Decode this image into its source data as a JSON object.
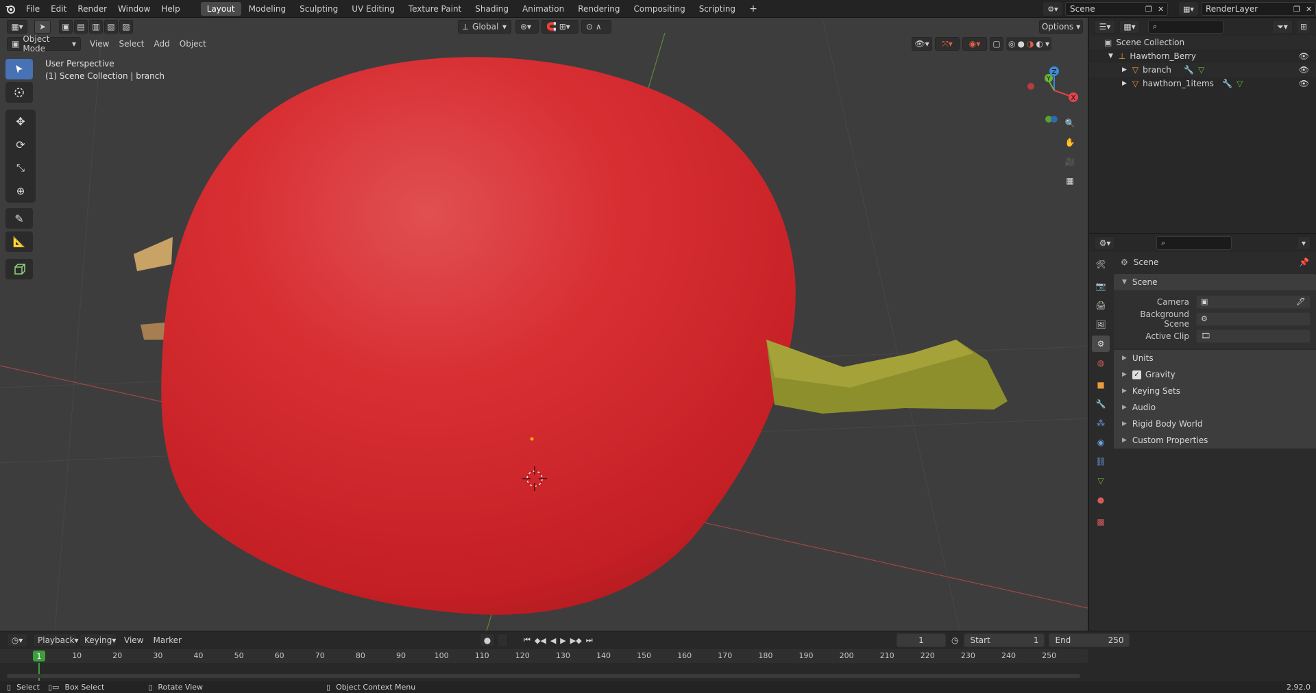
{
  "menu": [
    "File",
    "Edit",
    "Render",
    "Window",
    "Help"
  ],
  "workspaces": [
    "Layout",
    "Modeling",
    "Sculpting",
    "UV Editing",
    "Texture Paint",
    "Shading",
    "Animation",
    "Rendering",
    "Compositing",
    "Scripting"
  ],
  "active_workspace": "Layout",
  "scene_name": "Scene",
  "view_layer": "RenderLayer",
  "viewport": {
    "mode": "Object Mode",
    "menus": [
      "View",
      "Select",
      "Add",
      "Object"
    ],
    "transform_orientation": "Global",
    "options_label": "Options",
    "overlay_line1": "User Perspective",
    "overlay_line2": "(1) Scene Collection | branch",
    "gizmo_axes": {
      "x": "X",
      "y": "Y",
      "z": "Z"
    }
  },
  "outliner": {
    "root": "Scene Collection",
    "items": [
      {
        "label": "Hawthorn_Berry"
      },
      {
        "label": "branch"
      },
      {
        "label": "hawthorn_1items"
      }
    ]
  },
  "properties": {
    "context_title": "Scene",
    "panel_title": "Scene",
    "fields": [
      {
        "label": "Camera"
      },
      {
        "label": "Background Scene"
      },
      {
        "label": "Active Clip"
      }
    ],
    "subpanels": [
      "Units",
      "Gravity",
      "Keying Sets",
      "Audio",
      "Rigid Body World",
      "Custom Properties"
    ],
    "gravity_checked": true
  },
  "timeline": {
    "menus": [
      "Playback",
      "Keying",
      "View",
      "Marker"
    ],
    "current_frame": "1",
    "start_label": "Start",
    "start": "1",
    "end_label": "End",
    "end": "250",
    "ruler": [
      "1",
      "10",
      "20",
      "30",
      "40",
      "50",
      "60",
      "70",
      "80",
      "90",
      "100",
      "110",
      "120",
      "130",
      "140",
      "150",
      "160",
      "170",
      "180",
      "190",
      "200",
      "210",
      "220",
      "230",
      "240",
      "250"
    ]
  },
  "statusbar": {
    "select": "Select",
    "box_select": "Box Select",
    "rotate_view": "Rotate View",
    "context_menu": "Object Context Menu",
    "version": "2.92.0"
  },
  "colors": {
    "accent": "#4772b3",
    "berry": "#d42328",
    "background": "#3d3d3d",
    "x_axis": "#e0444e",
    "y_axis": "#6bb33a",
    "z_axis": "#3c8ad8",
    "active_frame": "#3d9e3d"
  }
}
